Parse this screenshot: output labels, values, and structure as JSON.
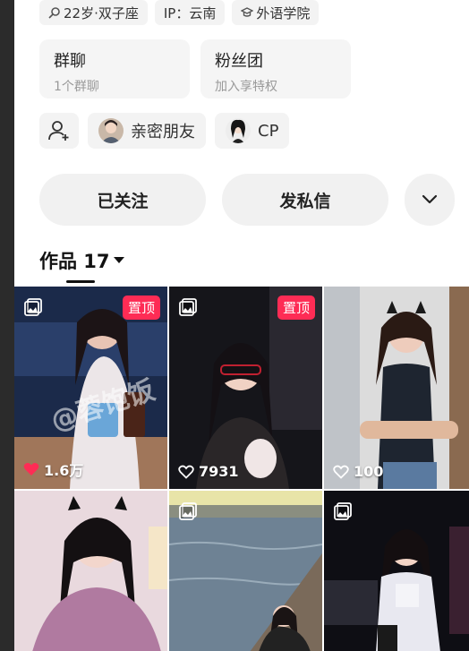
{
  "profile": {
    "tags": [
      {
        "icon": "gender-age-icon",
        "label": "22岁·双子座"
      },
      {
        "icon": "",
        "label": "IP：云南"
      },
      {
        "icon": "school-icon",
        "label": "外语学院"
      }
    ],
    "cards": [
      {
        "title": "群聊",
        "subtitle": "1个群聊"
      },
      {
        "title": "粉丝团",
        "subtitle": "加入享特权"
      }
    ],
    "relations": [
      {
        "label": "亲密朋友"
      },
      {
        "label": "CP"
      }
    ],
    "actions": {
      "follow_label": "已关注",
      "message_label": "发私信"
    }
  },
  "works": {
    "label": "作品 17"
  },
  "posts": [
    {
      "pinned": "置顶",
      "likes": "1.6万",
      "liked": true,
      "watermark": "@蓉饱饭",
      "colors": [
        "#1b2a4a",
        "#6d5a7a",
        "#c08a6a"
      ]
    },
    {
      "pinned": "置顶",
      "likes": "7931",
      "liked": false,
      "colors": [
        "#15151a",
        "#3a3030",
        "#7a6a60"
      ]
    },
    {
      "likes": "100",
      "liked": false,
      "colors": [
        "#dcdcdc",
        "#a0a6ae",
        "#334050"
      ]
    },
    {
      "colors": [
        "#e9c9d2",
        "#c98aa0",
        "#7a4060"
      ]
    },
    {
      "colors": [
        "#cfdbe8",
        "#7a8ea0",
        "#3a4a58"
      ]
    },
    {
      "colors": [
        "#0e0e14",
        "#3a2a3a",
        "#d8d8e8"
      ]
    }
  ],
  "theme": {
    "accent": "#fe2c55"
  }
}
